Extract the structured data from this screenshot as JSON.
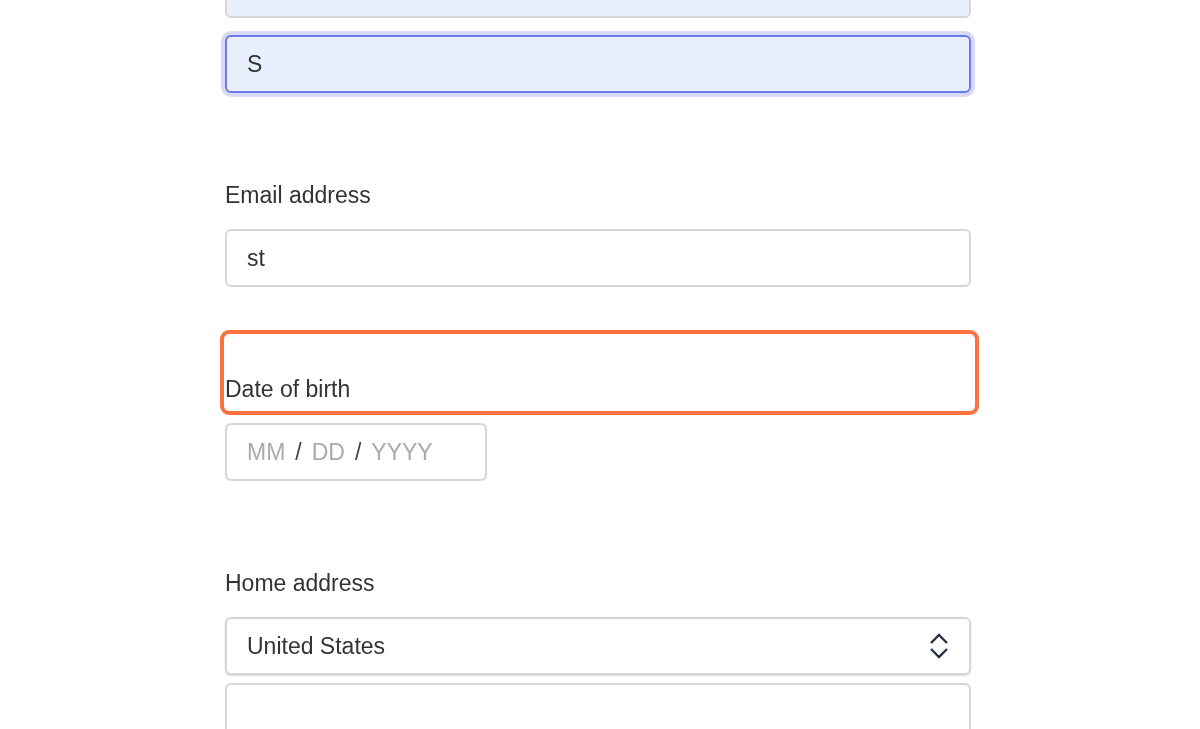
{
  "form": {
    "fields": [
      {
        "kind": "input",
        "autofilled": true,
        "focused": false
      },
      {
        "kind": "input",
        "value": "S",
        "autofilled": true,
        "focused": true
      },
      {
        "kind": "input",
        "label": "Email address",
        "value": "st",
        "autofilled": false,
        "focused": false,
        "highlighted": false
      },
      {
        "kind": "date",
        "label": "Date of birth",
        "highlighted": true,
        "parts": [
          {
            "placeholder": "MM"
          },
          {
            "separator": "/"
          },
          {
            "placeholder": "DD"
          },
          {
            "separator": "/"
          },
          {
            "placeholder": "YYYY"
          }
        ]
      },
      {
        "kind": "select",
        "label": "Home address",
        "value": "United States",
        "highlighted": false
      },
      {
        "kind": "input",
        "autofilled": false,
        "focused": false
      }
    ]
  }
}
